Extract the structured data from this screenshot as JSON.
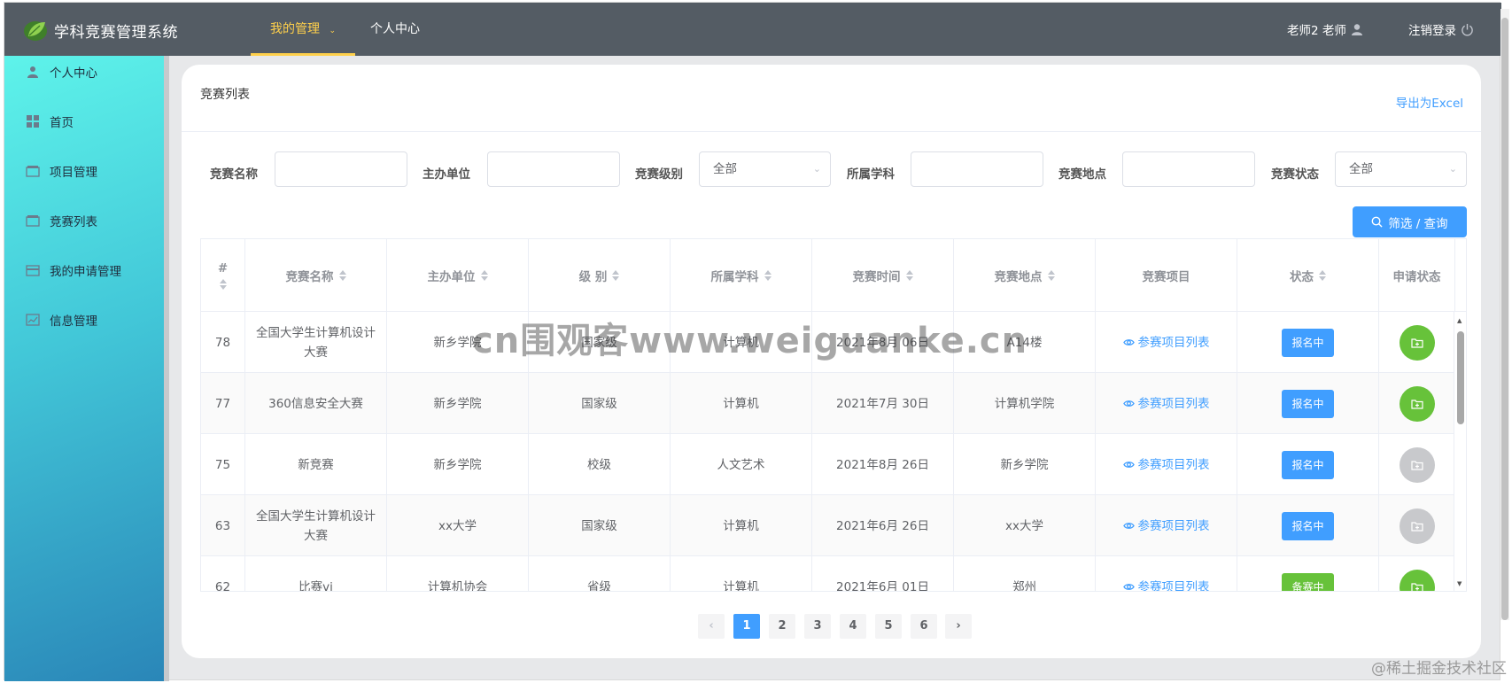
{
  "app": {
    "title": "学科竞赛管理系统",
    "nav": [
      {
        "label": "我的管理",
        "active": true
      },
      {
        "label": "个人中心",
        "active": false
      }
    ],
    "user_label": "老师2 老师",
    "logout_label": "注销登录"
  },
  "sidebar": {
    "items": [
      {
        "label": "个人中心",
        "icon": "user-icon"
      },
      {
        "label": "首页",
        "icon": "grid-icon"
      },
      {
        "label": "项目管理",
        "icon": "box-icon"
      },
      {
        "label": "竞赛列表",
        "icon": "box-icon"
      },
      {
        "label": "我的申请管理",
        "icon": "card-icon"
      },
      {
        "label": "信息管理",
        "icon": "chart-icon"
      }
    ]
  },
  "page": {
    "title": "竞赛列表",
    "export_label": "导出为Excel"
  },
  "filters": {
    "name_label": "竞赛名称",
    "org_label": "主办单位",
    "level_label": "竞赛级别",
    "level_value": "全部",
    "subject_label": "所属学科",
    "place_label": "竞赛地点",
    "status_label": "竞赛状态",
    "status_value": "全部",
    "search_label": "筛选 / 查询"
  },
  "table": {
    "headers": [
      "#",
      "竞赛名称",
      "主办单位",
      "级 别",
      "所属学科",
      "竞赛时间",
      "竞赛地点",
      "竞赛项目",
      "状态",
      "申请状态"
    ],
    "rows": [
      {
        "id": "78",
        "name": "全国大学生计算机设计大赛",
        "org": "新乡学院",
        "level": "国家级",
        "subject": "计算机",
        "time": "2021年8月 06日",
        "place": "A14楼",
        "project": "参赛项目列表",
        "status": "报名中",
        "apply": "green"
      },
      {
        "id": "77",
        "name": "360信息安全大赛",
        "org": "新乡学院",
        "level": "国家级",
        "subject": "计算机",
        "time": "2021年7月 30日",
        "place": "计算机学院",
        "project": "参赛项目列表",
        "status": "报名中",
        "apply": "green"
      },
      {
        "id": "75",
        "name": "新竞赛",
        "org": "新乡学院",
        "level": "校级",
        "subject": "人文艺术",
        "time": "2021年8月 26日",
        "place": "新乡学院",
        "project": "参赛项目列表",
        "status": "报名中",
        "apply": "gray"
      },
      {
        "id": "63",
        "name": "全国大学生计算机设计大赛",
        "org": "xx大学",
        "level": "国家级",
        "subject": "计算机",
        "time": "2021年6月 26日",
        "place": "xx大学",
        "project": "参赛项目列表",
        "status": "报名中",
        "apply": "gray"
      },
      {
        "id": "62",
        "name": "比赛vi",
        "org": "计算机协会",
        "level": "省级",
        "subject": "计算机",
        "time": "2021年6月 01日",
        "place": "郑州",
        "project": "参赛项目列表",
        "status": "备赛中",
        "apply": "green"
      }
    ]
  },
  "pagination": {
    "pages": [
      "1",
      "2",
      "3",
      "4",
      "5",
      "6"
    ],
    "current": "1",
    "prev": "‹",
    "next": "›"
  },
  "watermark": "cn围观客www.weiguanke.cn",
  "corner_mark": "@稀土掘金技术社区",
  "colors": {
    "header_bg": "#545c64",
    "active_nav": "#ffd04b",
    "primary": "#409eff",
    "success": "#67c23a",
    "disabled": "#c8c9cc"
  }
}
